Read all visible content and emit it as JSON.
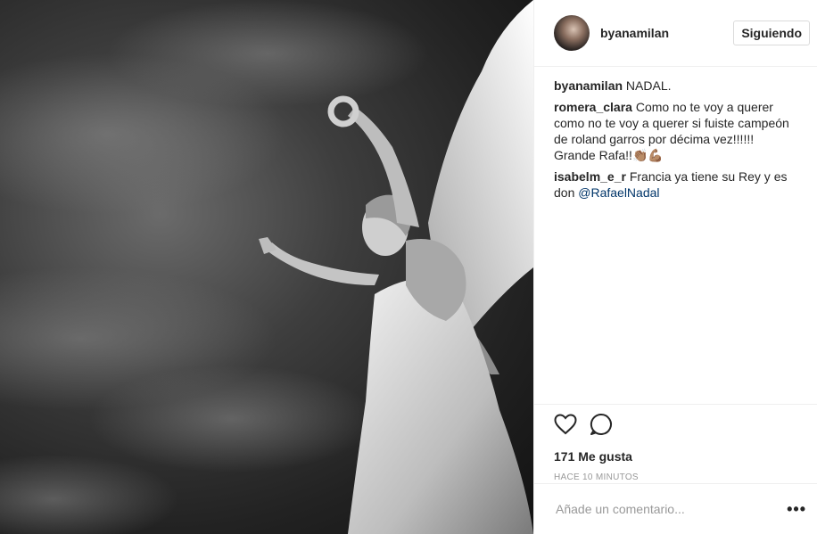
{
  "post": {
    "username": "byanamilan",
    "follow_label": "Siguiendo",
    "caption": {
      "author": "byanamilan",
      "text": "NADAL."
    },
    "comments": [
      {
        "author": "romera_clara",
        "text": "Como no te voy a querer como no te voy a querer si fuiste campeón de roland garros por décima vez!!!!!! Grande Rafa!!👏🏽💪🏽"
      },
      {
        "author": "isabelm_e_r",
        "text": "Francia ya tiene su Rey y es don ",
        "mention": "@RafaelNadal"
      }
    ],
    "likes": "171 Me gusta",
    "time": "HACE 10 MINUTOS",
    "comment_placeholder": "Añade un comentario...",
    "more_label": "•••"
  },
  "icons": {
    "like": "heart-icon",
    "comment": "speech-bubble-icon",
    "more": "more-options-icon"
  }
}
